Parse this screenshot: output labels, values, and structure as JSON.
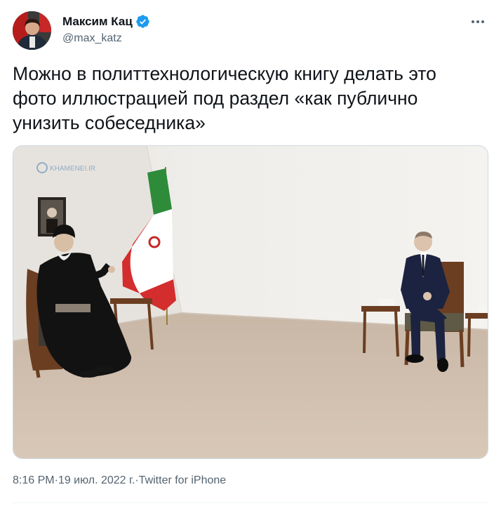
{
  "author": {
    "display_name": "Максим Кац",
    "handle": "@max_katz",
    "verified": true,
    "avatar_icon": "profile-photo"
  },
  "tweet": {
    "text": "Можно в политтехнологическую книгу делать это фото иллюстрацией под раздел «как публично унизить собеседника»",
    "photo_watermark": "KHAMENEI.IR"
  },
  "meta": {
    "time": "8:16 PM",
    "separator": " · ",
    "date": "19 июл. 2022 г.",
    "source": "Twitter for iPhone"
  },
  "colors": {
    "text_primary": "#0f1419",
    "text_secondary": "#536471",
    "verified_blue": "#1d9bf0"
  }
}
